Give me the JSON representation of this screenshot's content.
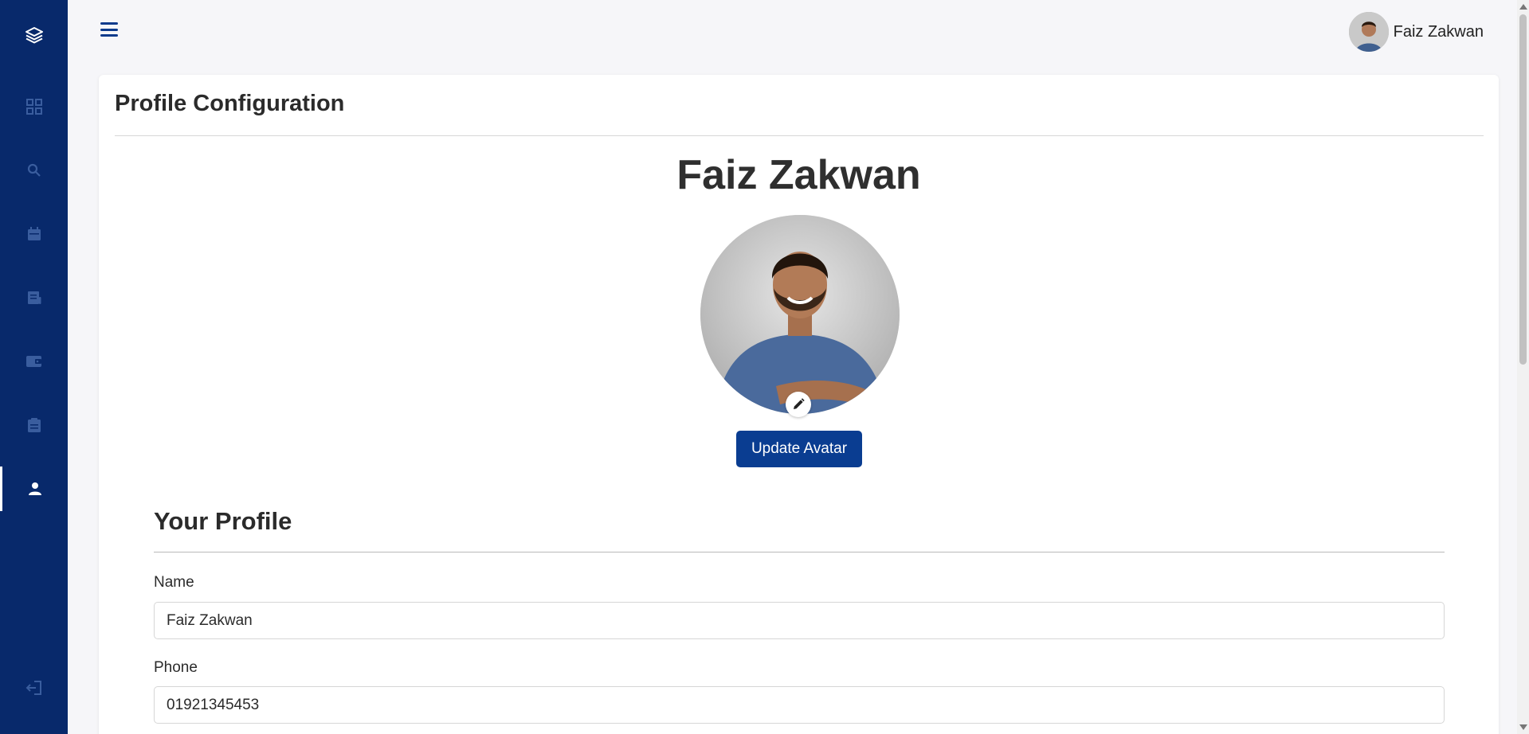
{
  "header": {
    "user_name": "Faiz Zakwan"
  },
  "sidebar": {
    "items": [
      {
        "icon": "dashboard-icon",
        "active": false
      },
      {
        "icon": "search-icon",
        "active": false
      },
      {
        "icon": "calendar-icon",
        "active": false
      },
      {
        "icon": "receipt-icon",
        "active": false
      },
      {
        "icon": "wallet-icon",
        "active": false
      },
      {
        "icon": "clipboard-icon",
        "active": false
      },
      {
        "icon": "user-icon",
        "active": true
      }
    ],
    "logout_icon": "logout-icon"
  },
  "page": {
    "title": "Profile Configuration",
    "profile_name": "Faiz Zakwan",
    "update_avatar_label": "Update Avatar"
  },
  "profile_form": {
    "section_title": "Your Profile",
    "name_label": "Name",
    "name_value": "Faiz Zakwan",
    "phone_label": "Phone",
    "phone_value": "01921345453"
  },
  "colors": {
    "sidebar": "#08296b",
    "accent": "#0a3d91",
    "background": "#f6f6f9"
  }
}
